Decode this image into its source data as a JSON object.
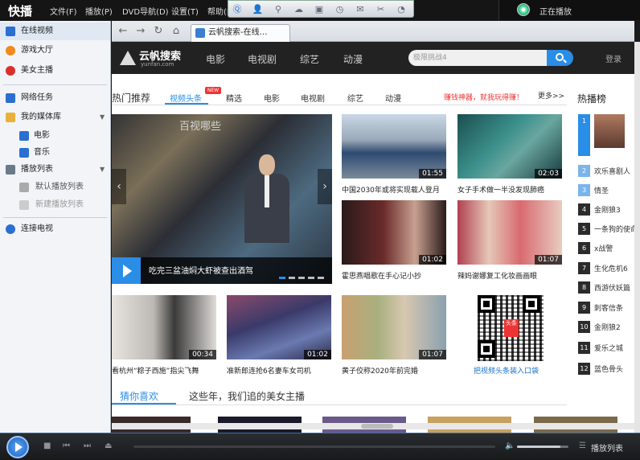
{
  "app": {
    "name": "快播",
    "menu": [
      "文件(F)",
      "播放(P)",
      "DVD导航(D)",
      "设置(T)",
      "帮助(H)"
    ],
    "now_playing": "正在播放"
  },
  "sidebar": {
    "items": [
      {
        "label": "在线视频",
        "icon": "online-video-icon",
        "color": "#2a6fd1"
      },
      {
        "label": "游戏大厅",
        "icon": "game-hall-icon",
        "color": "#f08a1c"
      },
      {
        "label": "美女主播",
        "icon": "live-host-icon",
        "color": "#d9302c"
      },
      {
        "label": "网络任务",
        "icon": "download-task-icon",
        "color": "#2a6fd1"
      },
      {
        "label": "我的媒体库",
        "icon": "media-library-icon",
        "color": "#e8b23a"
      },
      {
        "label": "电影",
        "icon": "movie-icon",
        "color": "#2a6fd1"
      },
      {
        "label": "音乐",
        "icon": "music-icon",
        "color": "#2a6fd1"
      },
      {
        "label": "播放列表",
        "icon": "playlist-icon",
        "color": "#6a7a8a"
      },
      {
        "label": "默认播放列表",
        "icon": "list-icon",
        "color": "#888888"
      },
      {
        "label": "新建播放列表",
        "icon": "add-list-icon",
        "color": "#888888"
      },
      {
        "label": "连接电视",
        "icon": "tv-connect-icon",
        "color": "#2a6fd1"
      }
    ]
  },
  "browser": {
    "tab_title": "云帆搜索-在线…",
    "site": {
      "brand_name": "云帆搜索",
      "brand_domain": "yunfan.com",
      "nav": [
        "电影",
        "电视剧",
        "综艺",
        "动漫"
      ],
      "search_placeholder": "极限挑战4",
      "login": "登录"
    },
    "row_tabs": {
      "heading": "热门推荐",
      "tabs": [
        "视频头条",
        "精选",
        "电影",
        "电视剧",
        "综艺",
        "动漫"
      ],
      "new_badge": "NEW",
      "promo": "赚钱神器，就我玩得赚！",
      "more": "更多>>",
      "rank_heading": "热播榜"
    },
    "hero": {
      "logo_text": "百视哪些",
      "caption": "吃完三盆油焖大虾被查出酒驾"
    },
    "videos": [
      {
        "title": "中国2030年或将实现载人登月",
        "duration": "01:55"
      },
      {
        "title": "女子手术做一半没发现肺癌",
        "duration": "02:03"
      },
      {
        "title": "霍思燕唱歌在手心记小抄",
        "duration": "01:02"
      },
      {
        "title": "辣妈谢娜复工化妆画画眼",
        "duration": "01:07"
      },
      {
        "title": "看杭州“粽子西施”指尖飞舞",
        "duration": "00:34"
      },
      {
        "title": "准新郎连抢6名妻车女司机",
        "duration": "01:02"
      },
      {
        "title": "黄子佼称2020年前完婚",
        "duration": "01:07"
      }
    ],
    "qr": {
      "badge": "头条",
      "title": "把视频头条装入口袋"
    },
    "rank": [
      "",
      "欢乐喜剧人",
      "情圣",
      "金刚狼3",
      "一条狗的使命",
      "x战警",
      "生化危机6",
      "西游伏妖篇",
      "刺客信条",
      "金刚狼2",
      "爱乐之城",
      "蓝色骨头"
    ],
    "bottom_tabs": [
      "猜你喜欢",
      "这些年，我们追的美女主播"
    ]
  },
  "player": {
    "playlist_label": "播放列表",
    "progress": 0,
    "volume": 0.85
  }
}
